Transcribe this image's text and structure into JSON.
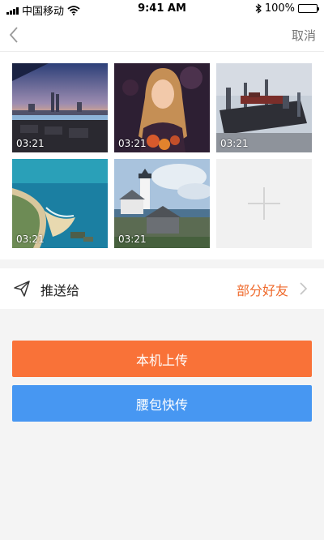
{
  "status_bar": {
    "carrier": "中国移动",
    "time": "9:41 AM",
    "battery": "100%"
  },
  "nav": {
    "cancel_label": "取消"
  },
  "media": {
    "items": [
      {
        "duration": "03:21"
      },
      {
        "duration": "03:21"
      },
      {
        "duration": "03:21"
      },
      {
        "duration": "03:21"
      },
      {
        "duration": "03:21"
      }
    ]
  },
  "send_to": {
    "label": "推送给",
    "value": "部分好友"
  },
  "buttons": {
    "local_upload": "本机上传",
    "wallet_transfer": "腰包快传"
  },
  "colors": {
    "accent_orange": "#f97238",
    "accent_blue": "#4797f2",
    "value_orange": "#ef6a2c"
  }
}
